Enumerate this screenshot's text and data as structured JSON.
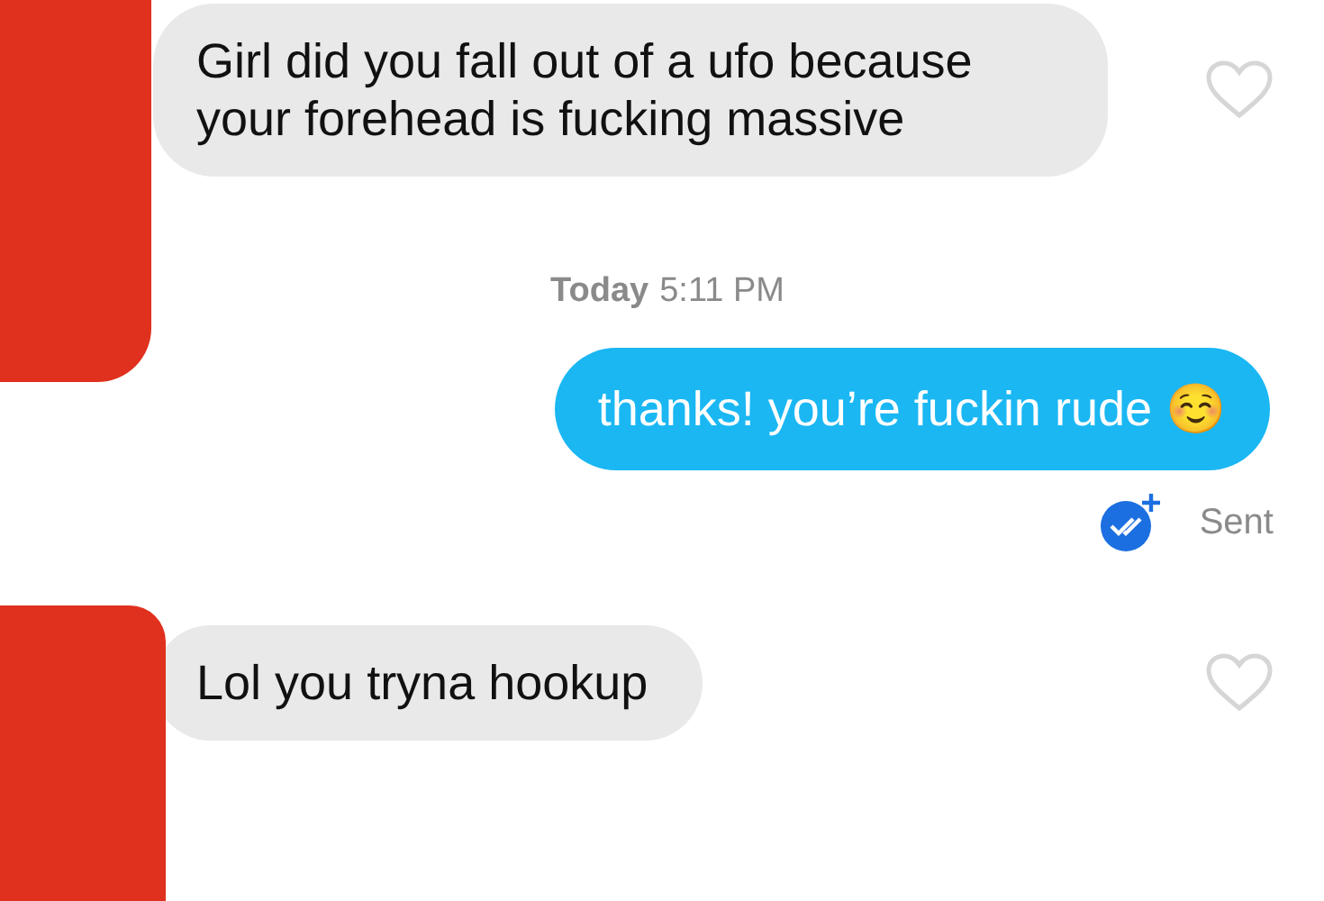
{
  "messages": [
    {
      "kind": "received",
      "text": "Girl did you fall out of a ufo because your forehead is fucking massive",
      "liked": false
    },
    {
      "kind": "timestamp",
      "day": "Today",
      "time": "5:11 PM"
    },
    {
      "kind": "sent",
      "text": "thanks! you’re fuckin rude ☺️",
      "status": "Sent"
    },
    {
      "kind": "received",
      "text": "Lol you tryna hookup",
      "liked": false
    }
  ]
}
